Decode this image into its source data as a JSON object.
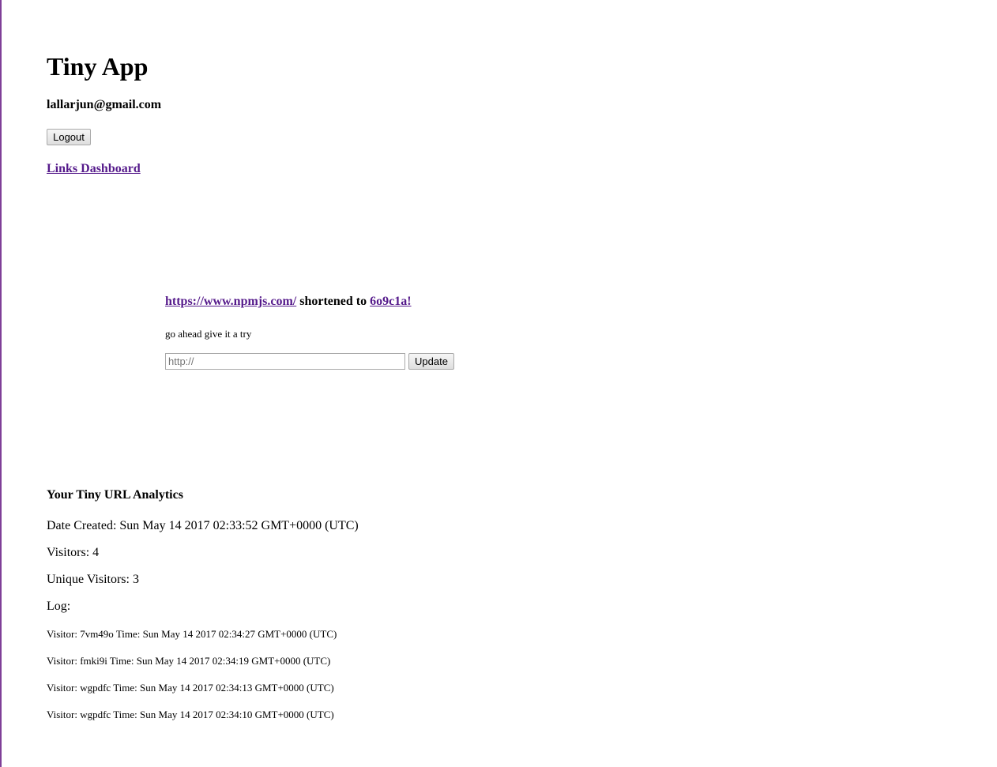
{
  "colors": {
    "link_visited": "#551a8b",
    "left_border": "#7f3f98"
  },
  "header": {
    "title": "Tiny App",
    "user_email": "lallarjun@gmail.com",
    "logout_label": "Logout",
    "nav_link_label": "Links Dashboard"
  },
  "shortened": {
    "long_url": "https://www.npmjs.com/",
    "middle_text": " shortened to ",
    "short_code": "6o9c1a!",
    "hint": "go ahead give it a try",
    "input_value": "",
    "input_placeholder": "http://",
    "update_label": "Update"
  },
  "analytics": {
    "heading": "Your Tiny URL Analytics",
    "date_created": "Date Created: Sun May 14 2017 02:33:52 GMT+0000 (UTC)",
    "visitors": "Visitors: 4",
    "unique_visitors": "Unique Visitors: 3",
    "log_label": "Log:",
    "log": [
      "Visitor: 7vm49o Time: Sun May 14 2017 02:34:27 GMT+0000 (UTC)",
      "Visitor: fmki9i Time: Sun May 14 2017 02:34:19 GMT+0000 (UTC)",
      "Visitor: wgpdfc Time: Sun May 14 2017 02:34:13 GMT+0000 (UTC)",
      "Visitor: wgpdfc Time: Sun May 14 2017 02:34:10 GMT+0000 (UTC)"
    ]
  }
}
